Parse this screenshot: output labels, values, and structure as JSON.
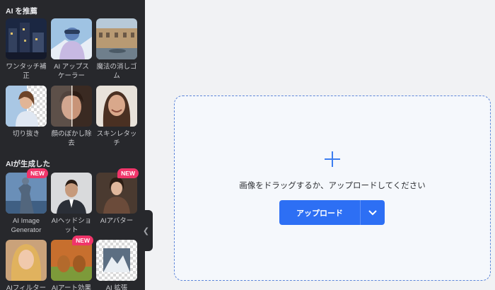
{
  "sidebar": {
    "section_recommended": "AI を推薦",
    "recommended": [
      {
        "label": "ワンタッチ補正",
        "icon": "photo-city-night"
      },
      {
        "label": "AI アップスケーラー",
        "icon": "photo-winter-person"
      },
      {
        "label": "魔法の消しゴム",
        "icon": "photo-building"
      },
      {
        "label": "切り抜き",
        "icon": "photo-woman-transparent"
      },
      {
        "label": "顔のぼかし除去",
        "icon": "photo-face-split"
      },
      {
        "label": "スキンレタッチ",
        "icon": "photo-woman-smile"
      }
    ],
    "section_generated": "AIが生成した",
    "generated": [
      {
        "label": "AI Image Generator",
        "badge": "NEW",
        "icon": "photo-statue"
      },
      {
        "label": "AIヘッドショット",
        "badge": "",
        "icon": "photo-man-suit"
      },
      {
        "label": "AIアバター",
        "badge": "NEW",
        "icon": "photo-woman-gown"
      },
      {
        "label": "AIフィルター",
        "badge": "",
        "icon": "photo-blonde"
      },
      {
        "label": "AIアート効果",
        "badge": "NEW",
        "icon": "photo-dogs"
      },
      {
        "label": "AI 拡張",
        "badge": "",
        "icon": "photo-mountains"
      }
    ],
    "collapse_icon": "chevron-left-icon"
  },
  "main": {
    "drop_text": "画像をドラッグするか、アップロードしてください",
    "upload_label": "アップロード",
    "plus_icon": "plus-icon",
    "dropdown_icon": "chevron-down-icon"
  },
  "colors": {
    "sidebar_bg": "#27282c",
    "accent": "#2d6ff4",
    "badge": "#f0356a"
  }
}
